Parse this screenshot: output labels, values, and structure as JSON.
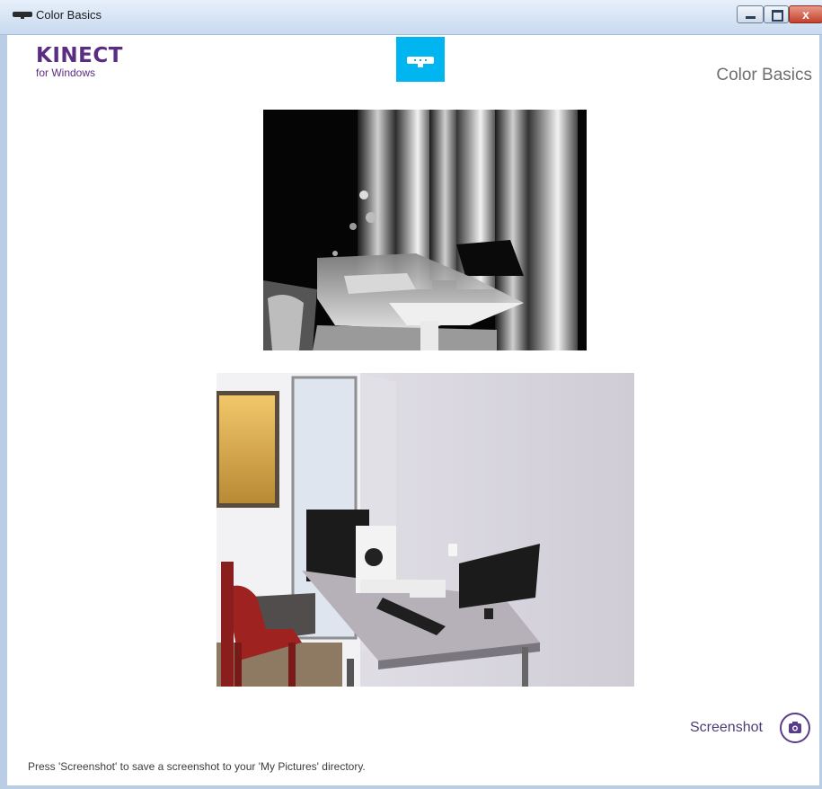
{
  "window": {
    "title": "Color Basics",
    "controls": {
      "minimize": "–",
      "maximize": "□",
      "close": "x"
    }
  },
  "brand": {
    "name": "KINECT",
    "tagline": "for Windows"
  },
  "header": {
    "app_title": "Color Basics"
  },
  "main": {
    "depth_view": {
      "icon": "depth-image"
    },
    "color_view": {
      "icon": "color-camera-image"
    }
  },
  "footer": {
    "screenshot_label": "Screenshot",
    "status": "Press 'Screenshot' to save a screenshot to your 'My Pictures' directory."
  },
  "colors": {
    "brand_purple": "#5a2d82",
    "sensor_blue": "#00b5f0",
    "button_purple": "#5a3d8a"
  }
}
